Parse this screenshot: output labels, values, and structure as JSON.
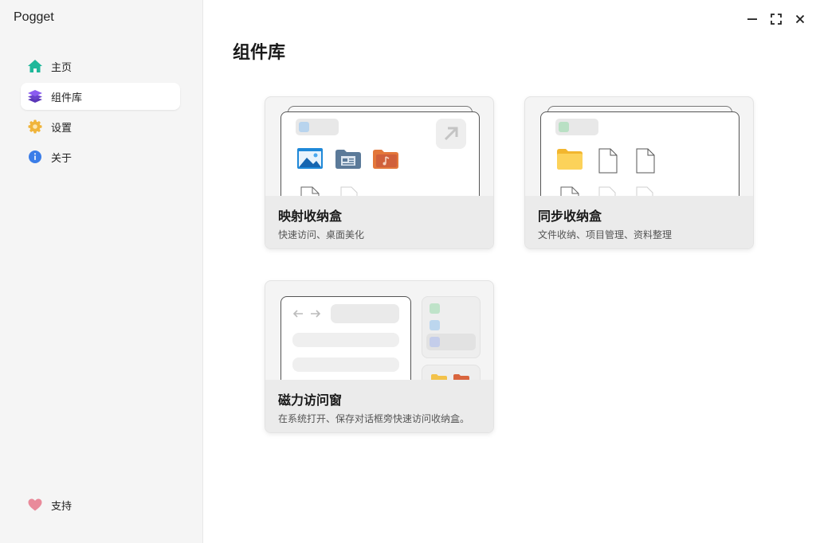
{
  "app": {
    "title": "Pogget"
  },
  "sidebar": {
    "items": [
      {
        "label": "主页",
        "icon": "home-icon",
        "active": false
      },
      {
        "label": "组件库",
        "icon": "layers-icon",
        "active": true
      },
      {
        "label": "设置",
        "icon": "gear-icon",
        "active": false
      },
      {
        "label": "关于",
        "icon": "info-icon",
        "active": false
      }
    ],
    "support": {
      "label": "支持",
      "icon": "heart-icon"
    }
  },
  "window": {
    "controls": [
      "minimize-icon",
      "maximize-icon",
      "close-icon"
    ]
  },
  "main": {
    "title": "组件库",
    "cards": [
      {
        "title": "映射收纳盒",
        "desc": "快速访问、桌面美化"
      },
      {
        "title": "同步收纳盒",
        "desc": "文件收纳、项目管理、资料整理"
      },
      {
        "title": "磁力访问窗",
        "desc": "在系统打开、保存对话框旁快速访问收纳盒。"
      }
    ]
  },
  "colors": {
    "home": "#1fb89a",
    "layers": "#7b4fe0",
    "gear": "#f0b43a",
    "info": "#3b7de8",
    "heart": "#e98a9a"
  }
}
